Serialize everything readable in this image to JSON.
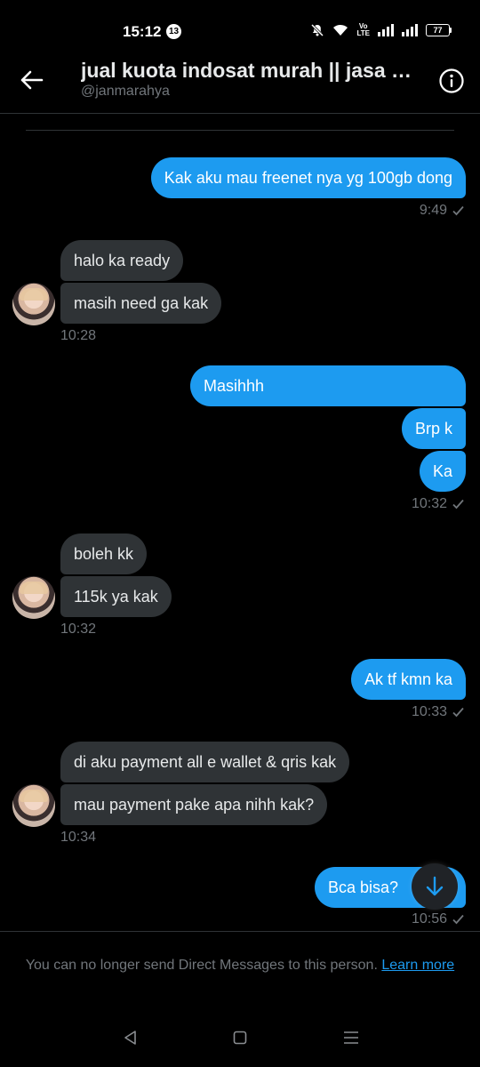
{
  "status_bar": {
    "time": "15:12",
    "notification_count": "13",
    "volte": "Vo\nLTE",
    "battery": "77"
  },
  "header": {
    "title": "jual kuota indosat murah || jasa …",
    "handle": "@janmarahya"
  },
  "messages": [
    {
      "text": "Kak aku mau freenet nya yg 100gb dong"
    },
    {
      "time": "9:49"
    },
    {
      "text": "halo ka ready"
    },
    {
      "text": "masih need ga kak"
    },
    {
      "time": "10:28"
    },
    {
      "text": "Masihhh"
    },
    {
      "text": "Brp k"
    },
    {
      "text": "Ka"
    },
    {
      "time": "10:32"
    },
    {
      "text": "boleh kk"
    },
    {
      "text": "115k ya kak"
    },
    {
      "time": "10:32"
    },
    {
      "text": "Ak tf kmn ka"
    },
    {
      "time": "10:33"
    },
    {
      "text": "di aku payment all e wallet & qris kak"
    },
    {
      "text": "mau payment pake apa nihh kak?"
    },
    {
      "time": "10:34"
    },
    {
      "text": "Bca bisa?"
    },
    {
      "time": "10:56"
    }
  ],
  "footer": {
    "notice": "You can no longer send Direct Messages to this person.",
    "link": "Learn more"
  },
  "colors": {
    "accent": "#1d9bf0",
    "incoming_bubble": "#2f3336",
    "muted": "#71767b"
  }
}
